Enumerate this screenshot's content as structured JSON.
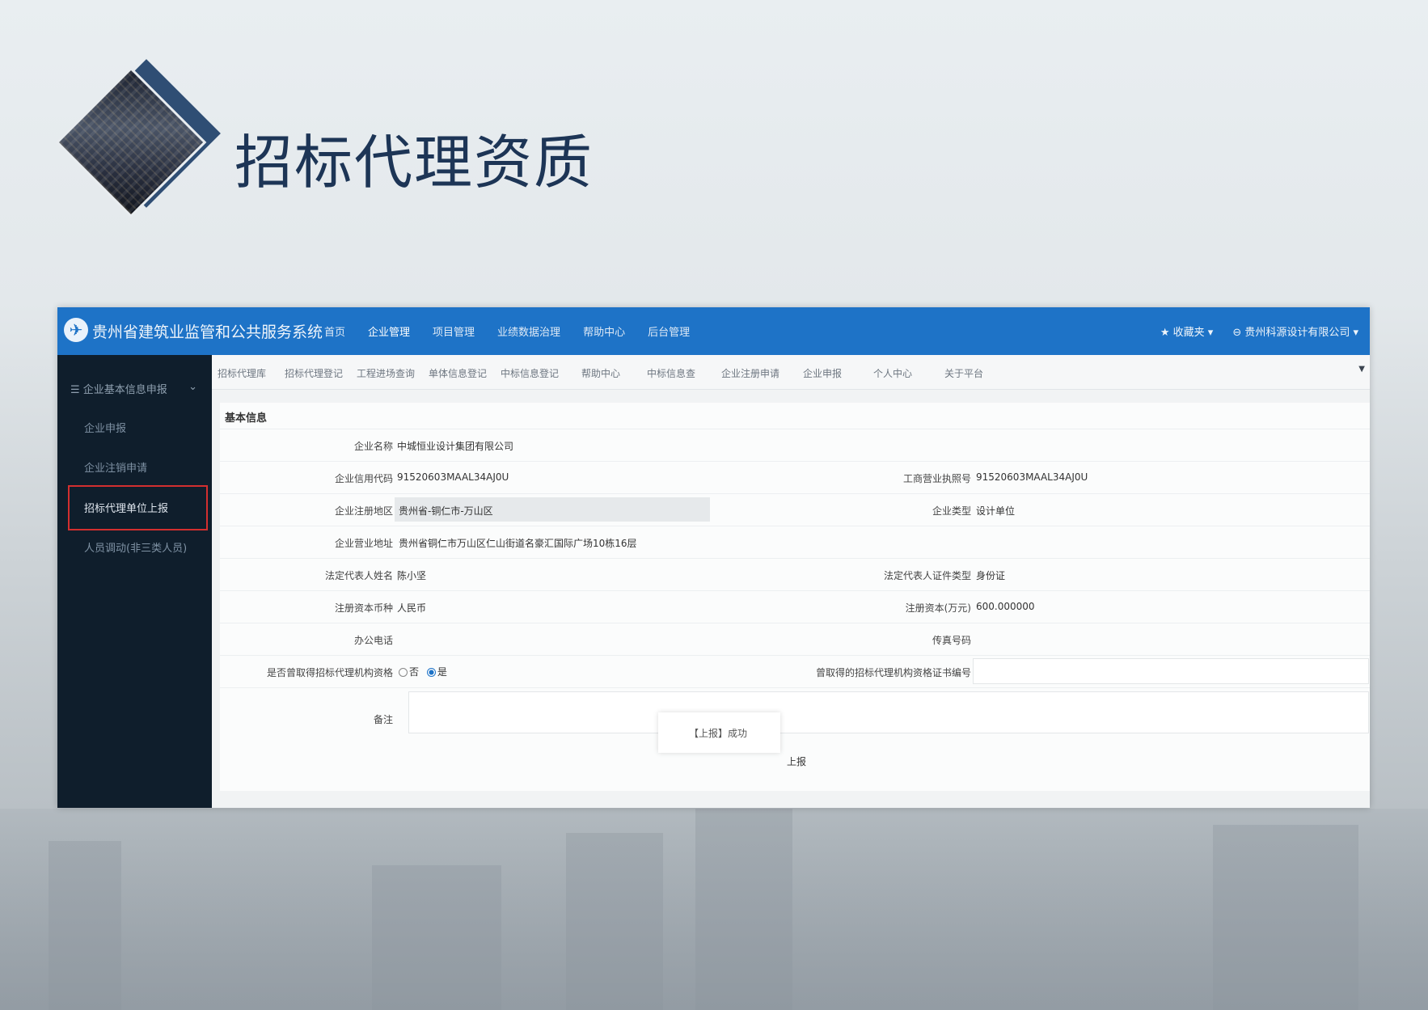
{
  "slide": {
    "title": "招标代理资质"
  },
  "header": {
    "system_title": "贵州省建筑业监管和公共服务系统",
    "nav": [
      "首页",
      "企业管理",
      "项目管理",
      "业绩数据治理",
      "帮助中心",
      "后台管理"
    ],
    "favorites": "★ 收藏夹 ▾",
    "company": "⊖ 贵州科源设计有限公司 ▾"
  },
  "sidebar": {
    "group": "企业基本信息申报",
    "items": [
      "企业申报",
      "企业注销申请",
      "招标代理单位上报",
      "人员调动(非三类人员)"
    ],
    "active_index": 2
  },
  "subnav": {
    "tabs": [
      "招标代理库",
      "招标代理登记",
      "工程进场查询",
      "单体信息登记",
      "中标信息登记",
      "帮助中心",
      "中标信息查",
      "企业注册申请",
      "企业申报",
      "个人中心",
      "关于平台"
    ]
  },
  "form": {
    "section_title": "基本信息",
    "company_name_label": "企业名称",
    "company_name": "中城恒业设计集团有限公司",
    "credit_code_label": "企业信用代码",
    "credit_code": "91520603MAAL34AJ0U",
    "license_no_label": "工商营业执照号",
    "license_no": "91520603MAAL34AJ0U",
    "region_label": "企业注册地区",
    "region": "贵州省-铜仁市-万山区",
    "company_type_label": "企业类型",
    "company_type": "设计单位",
    "address_label": "企业营业地址",
    "address": "贵州省铜仁市万山区仁山街道名豪汇国际广场10栋16层",
    "legal_rep_label": "法定代表人姓名",
    "legal_rep": "陈小坚",
    "id_type_label": "法定代表人证件类型",
    "id_type": "身份证",
    "currency_label": "注册资本币种",
    "currency": "人民币",
    "capital_label": "注册资本(万元)",
    "capital": "600.000000",
    "phone_label": "办公电话",
    "fax_label": "传真号码",
    "qualified_label": "是否曾取得招标代理机构资格",
    "option_no": "否",
    "option_yes": "是",
    "cert_label": "曾取得的招标代理机构资格证书编号",
    "remark_label": "备注",
    "toast": "【上报】成功",
    "submit": "上报"
  }
}
